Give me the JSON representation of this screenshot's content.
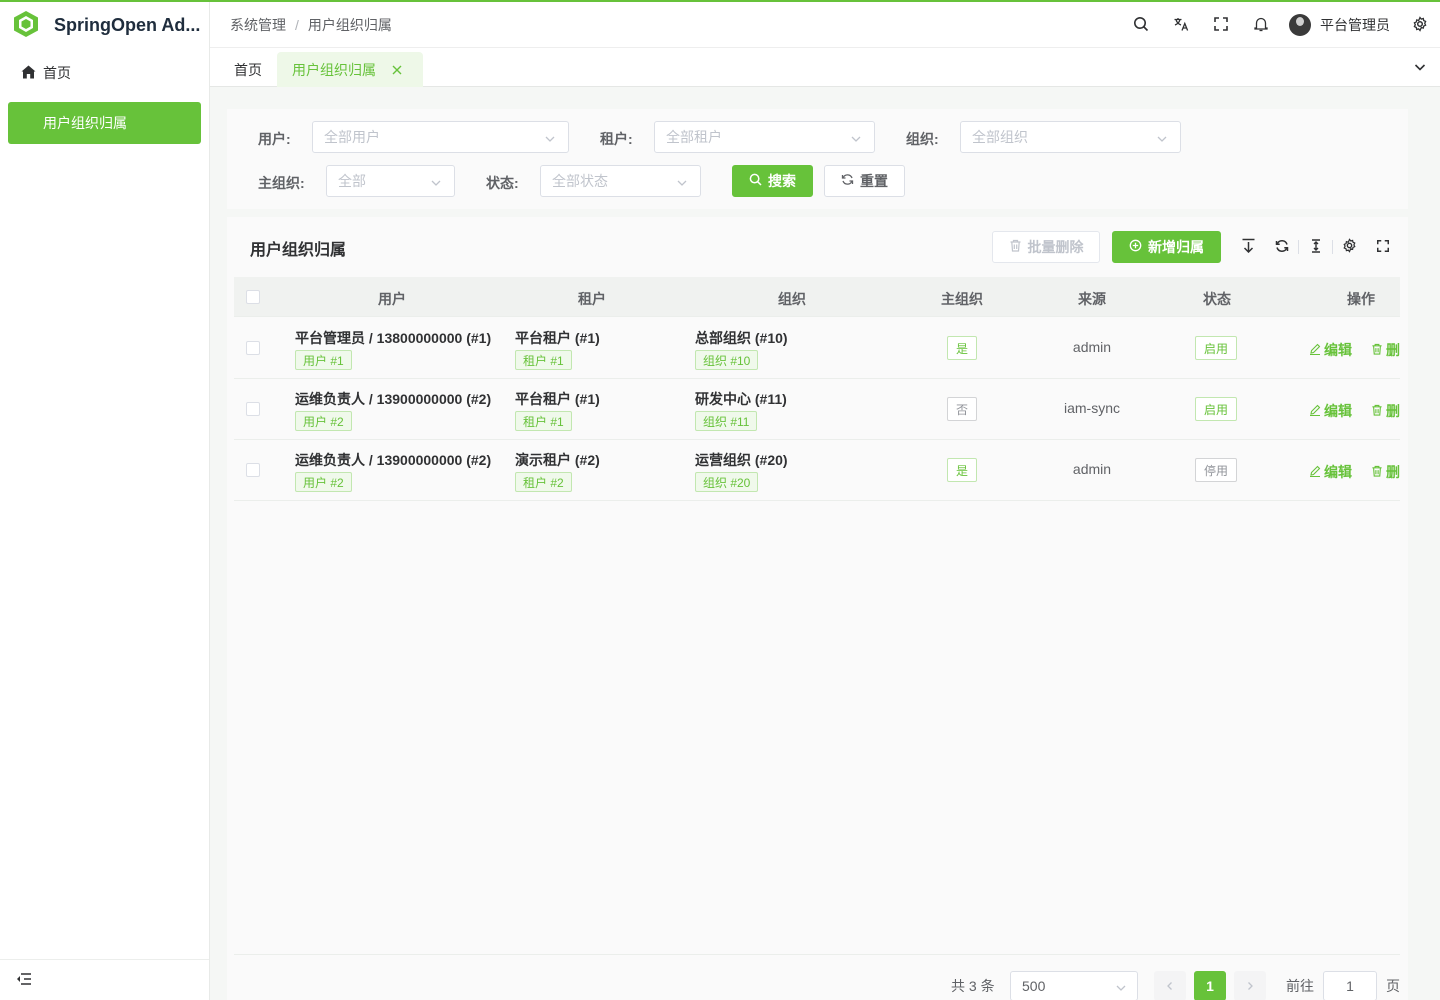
{
  "app": {
    "name": "SpringOpen Ad...",
    "brand_color": "#67c23a"
  },
  "sidebar": {
    "items": [
      {
        "label": "首页",
        "icon": "home-icon"
      },
      {
        "label": "用户组织归属",
        "active": true
      }
    ],
    "collapse_icon": "menu-fold-icon"
  },
  "header": {
    "breadcrumb": [
      "系统管理",
      "用户组织归属"
    ],
    "icons": [
      "search-icon",
      "translate-icon",
      "fullscreen-icon",
      "bell-icon"
    ],
    "user_name": "平台管理员",
    "settings_icon": "gear-icon"
  },
  "tabs": [
    {
      "label": "首页"
    },
    {
      "label": "用户组织归属",
      "active": true,
      "closable": true
    }
  ],
  "search": {
    "user_label": "用户:",
    "user_placeholder": "全部用户",
    "tenant_label": "租户:",
    "tenant_placeholder": "全部租户",
    "org_label": "组织:",
    "org_placeholder": "全部组织",
    "main_org_label": "主组织:",
    "main_org_placeholder": "全部",
    "status_label": "状态:",
    "status_placeholder": "全部状态",
    "search_button": "搜索",
    "reset_button": "重置"
  },
  "table": {
    "title": "用户组织归属",
    "batch_delete": "批量删除",
    "add_button": "新增归属",
    "columns": [
      "用户",
      "租户",
      "组织",
      "主组织",
      "来源",
      "状态",
      "操作"
    ],
    "rows": [
      {
        "user": "平台管理员 / 13800000000 (#1)",
        "user_tag": "用户 #1",
        "tenant": "平台租户 (#1)",
        "tenant_tag": "租户 #1",
        "org": "总部组织 (#10)",
        "org_tag": "组织 #10",
        "main": "是",
        "source": "admin",
        "status": "启用",
        "edit": "编辑",
        "delete": "删"
      },
      {
        "user": "运维负责人 / 13900000000 (#2)",
        "user_tag": "用户 #2",
        "tenant": "平台租户 (#1)",
        "tenant_tag": "租户 #1",
        "org": "研发中心 (#11)",
        "org_tag": "组织 #11",
        "main": "否",
        "source": "iam-sync",
        "status": "启用",
        "edit": "编辑",
        "delete": "删"
      },
      {
        "user": "运维负责人 / 13900000000 (#2)",
        "user_tag": "用户 #2",
        "tenant": "演示租户 (#2)",
        "tenant_tag": "租户 #2",
        "org": "运营组织 (#20)",
        "org_tag": "组织 #20",
        "main": "是",
        "source": "admin",
        "status": "停用",
        "edit": "编辑",
        "delete": "删"
      }
    ]
  },
  "pagination": {
    "total": "共 3 条",
    "page_size": "500",
    "current_page": "1",
    "goto_label": "前往",
    "goto_value": "1",
    "page_suffix": "页"
  }
}
